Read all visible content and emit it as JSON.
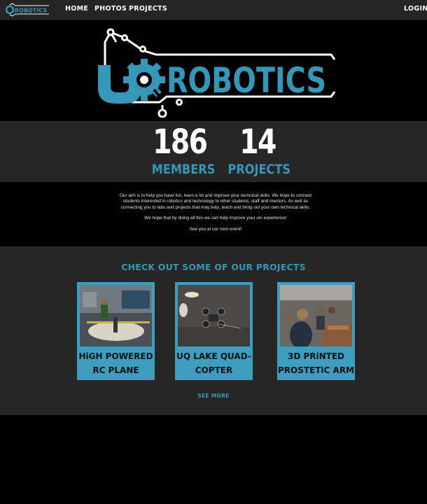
{
  "nav": {
    "logo_text": "UQ ROBOTICS",
    "links": [
      "HOME",
      "PHOTOS",
      "PROJECTS"
    ],
    "login": "LOGIN"
  },
  "hero": {
    "logo_text": "UQ ROBOTICS",
    "wordmark": "ROBOTICS",
    "monogram": "UQ"
  },
  "stats": [
    {
      "number": "186",
      "label": "MEMBERS"
    },
    {
      "number": "14",
      "label": "PROJECTS"
    }
  ],
  "about": {
    "paragraphs": [
      "Our aim is to help you have fun, learn a lot and improve your technical skills. We hope to connect students interested in robotics and technology to other students, staff and mentors. As well as connecting you to labs and projects that may help, teach and bring out your own technical skills.",
      "We hope that by doing all this we can help improve your uni experience!",
      "See you at our next event!"
    ]
  },
  "projects": {
    "heading": "CHECK OUT SOME OF OUR PROJECTS",
    "cards": [
      {
        "line1": "HiGH POWERED",
        "line2": "RC PLANE"
      },
      {
        "line1": "UQ LAKE QUAD-",
        "line2": "COPTER"
      },
      {
        "line1": "3D PRiNTED",
        "line2": "PROSTETiC ARM"
      }
    ],
    "see_more": "SEE MORE"
  },
  "colors": {
    "accent": "#3597b8",
    "card": "#3d9ebf",
    "band": "#262626",
    "nav": "#232323"
  }
}
